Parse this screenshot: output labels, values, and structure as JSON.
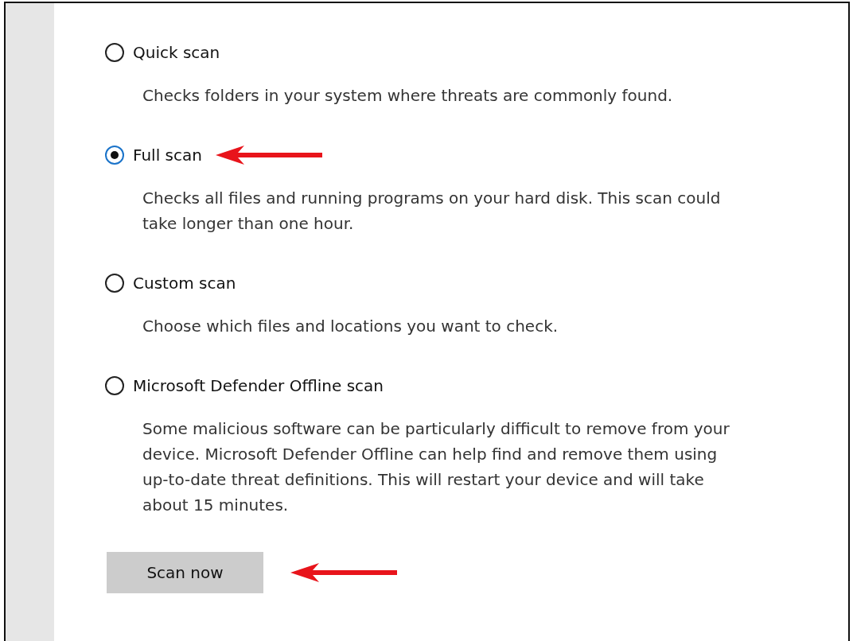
{
  "scan_options": [
    {
      "label": "Quick scan",
      "selected": false,
      "pointer": false,
      "description": "Checks folders in your system where threats are commonly found."
    },
    {
      "label": "Full scan",
      "selected": true,
      "pointer": true,
      "description": "Checks all files and running programs on your hard disk. This scan could take longer than one hour."
    },
    {
      "label": "Custom scan",
      "selected": false,
      "pointer": false,
      "description": "Choose which files and locations you want to check."
    },
    {
      "label": "Microsoft Defender Offline scan",
      "selected": false,
      "pointer": false,
      "description": "Some malicious software can be particularly difficult to remove from your device. Microsoft Defender Offline can help find and remove them using up-to-date threat definitions. This will restart your device and will take about 15 minutes."
    }
  ],
  "scan_button": {
    "label": "Scan now",
    "pointer": true
  }
}
